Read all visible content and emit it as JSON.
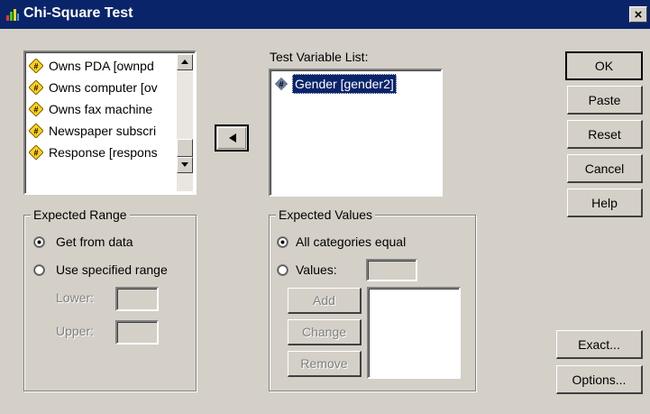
{
  "window": {
    "title": "Chi-Square Test",
    "close_label": "×"
  },
  "source_list": {
    "items": [
      {
        "label": "Owns PDA [ownpd"
      },
      {
        "label": "Owns computer [ov"
      },
      {
        "label": "Owns fax machine"
      },
      {
        "label": "Newspaper subscri"
      },
      {
        "label": "Response [respons"
      }
    ]
  },
  "move_button_icon": "left-arrow-icon",
  "test_variables": {
    "label": "Test Variable List:",
    "items": [
      {
        "label": "Gender [gender2]",
        "selected": true
      }
    ]
  },
  "buttons": {
    "ok": "OK",
    "paste": "Paste",
    "reset": "Reset",
    "cancel": "Cancel",
    "help": "Help",
    "exact": "Exact...",
    "options": "Options..."
  },
  "expected_range": {
    "label": "Expected Range",
    "options": [
      {
        "label": "Get from data",
        "checked": true
      },
      {
        "label": "Use specified range",
        "checked": false
      }
    ],
    "lower_label": "Lower:",
    "upper_label": "Upper:",
    "lower_value": "",
    "upper_value": ""
  },
  "expected_values": {
    "label": "Expected Values",
    "options": [
      {
        "label": "All categories equal",
        "checked": true
      },
      {
        "label": "Values:",
        "checked": false
      }
    ],
    "value_input": "",
    "buttons": {
      "add": "Add",
      "change": "Change",
      "remove": "Remove"
    }
  },
  "colors": {
    "titlebar": "#0a246a",
    "selection": "#0a246a",
    "face": "#d4d0c8"
  }
}
